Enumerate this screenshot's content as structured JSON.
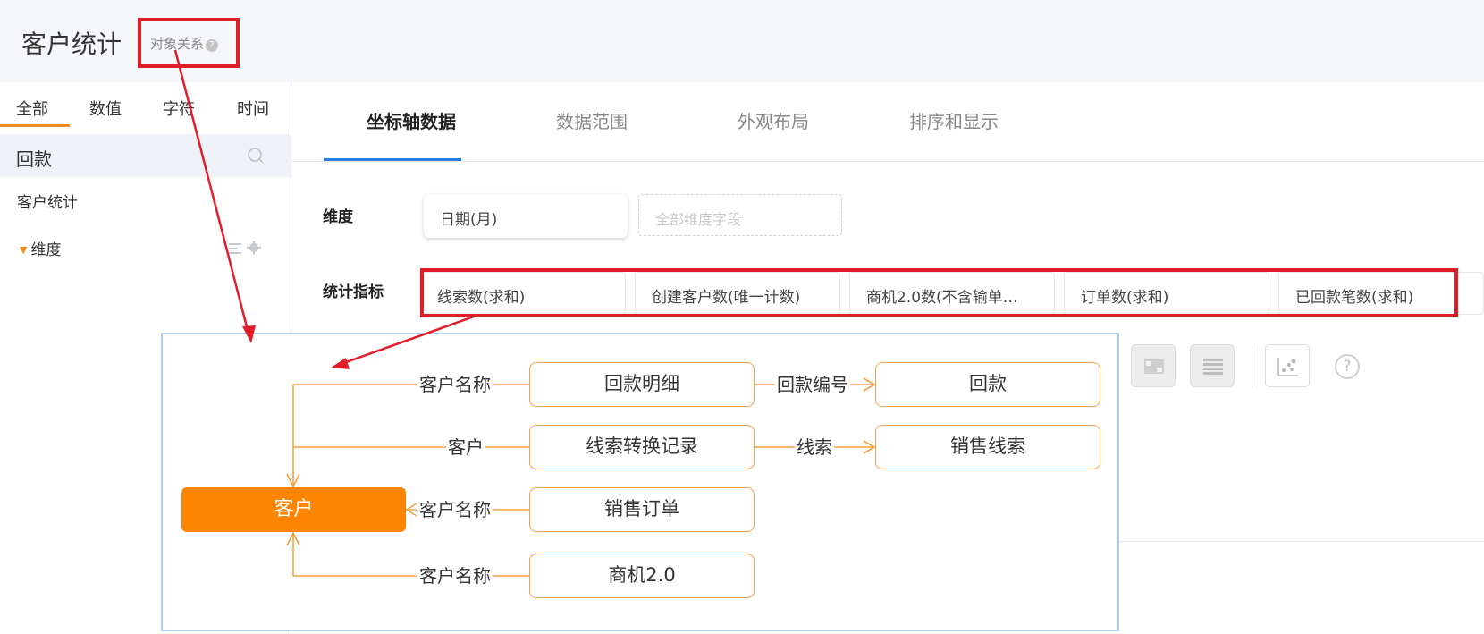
{
  "header": {
    "title": "客户统计",
    "relation_link": "对象关系",
    "help_glyph": "?"
  },
  "left_panel": {
    "type_tabs": [
      "全部",
      "数值",
      "字符",
      "时间"
    ],
    "active_type_tab": "全部",
    "search_value": "回款",
    "tree_root": "客户统计",
    "dimension_node": "维度"
  },
  "config_tabs": {
    "items": [
      "坐标轴数据",
      "数据范围",
      "外观布局",
      "排序和显示"
    ],
    "active": "坐标轴数据"
  },
  "dimension": {
    "label": "维度",
    "value": "日期(月)",
    "placeholder": "全部维度字段"
  },
  "metrics": {
    "label": "统计指标",
    "items": [
      "线索数(求和)",
      "创建客户数(唯一计数)",
      "商机2.0数(不含输单…",
      "订单数(求和)",
      "已回款笔数(求和)"
    ]
  },
  "chart_toolbar": {
    "icons": [
      "table-chart-icon",
      "grid-chart-icon",
      "scatter-chart-icon"
    ],
    "help_glyph": "?"
  },
  "relation_diagram": {
    "center_node": "客户",
    "rows": [
      {
        "edge": "客户名称",
        "node": "回款明细",
        "next_edge": "回款编号",
        "next_node": "回款"
      },
      {
        "edge": "客户",
        "node": "线索转换记录",
        "next_edge": "线索",
        "next_node": "销售线索"
      },
      {
        "edge": "客户名称",
        "node": "销售订单"
      },
      {
        "edge": "客户名称",
        "node": "商机2.0"
      }
    ]
  },
  "colors": {
    "accent_orange": "#ff8400",
    "node_border": "#f5a042",
    "highlight_red": "#e01e2a",
    "tab_active_blue": "#2a7de1"
  }
}
